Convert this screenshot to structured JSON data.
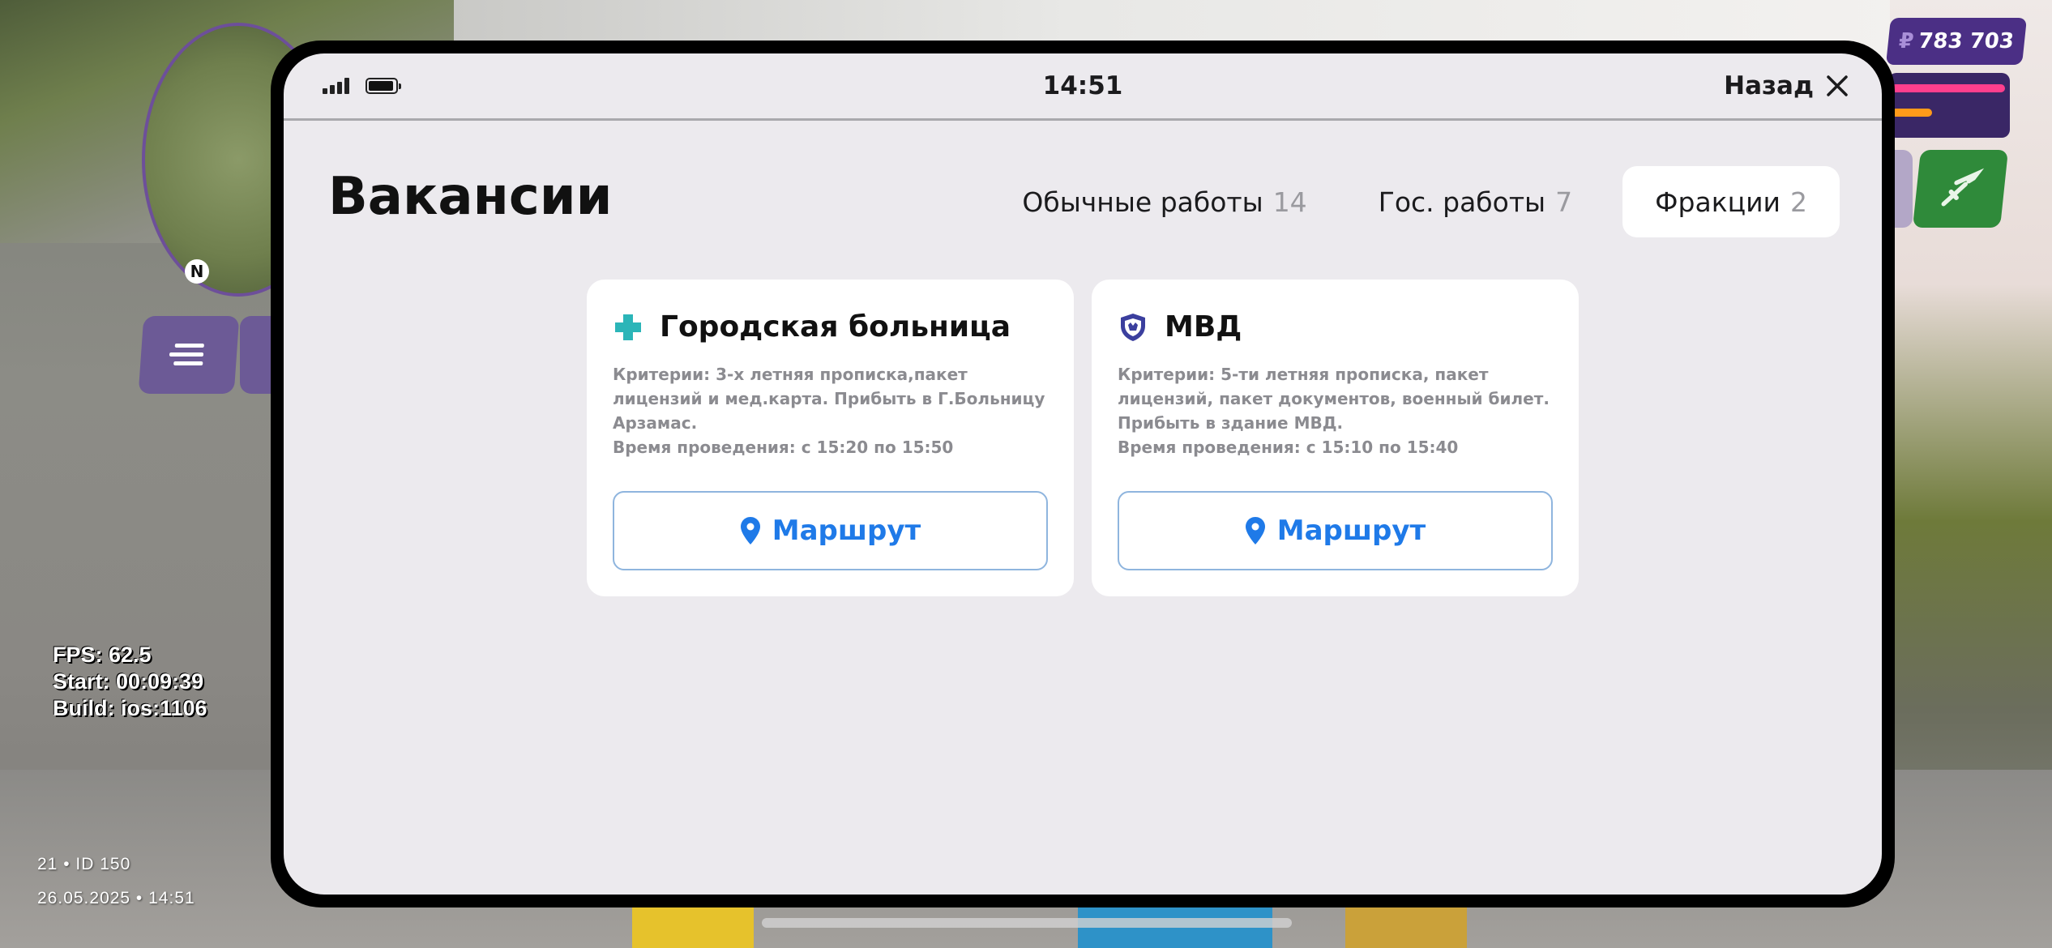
{
  "hud": {
    "money_currency": "₽",
    "money_value": "783 703",
    "compass": "N",
    "debug": {
      "fps": "FPS: 62.5",
      "start": "Start: 00:09:39",
      "build": "Build: ios:1106"
    },
    "footer_id": "21 • ID 150",
    "footer_datetime": "26.05.2025 • 14:51"
  },
  "phone": {
    "time": "14:51",
    "back_label": "Назад",
    "page_title": "Вакансии",
    "tabs": [
      {
        "label": "Обычные работы",
        "count": "14",
        "active": false
      },
      {
        "label": "Гос. работы",
        "count": "7",
        "active": false
      },
      {
        "label": "Фракции",
        "count": "2",
        "active": true
      }
    ],
    "cards": [
      {
        "icon": "medical-cross-icon",
        "title": "Городская больница",
        "desc1": "Критерии: 3-х летняя прописка,пакет лицензий и мед.карта. Прибыть в Г.Больницу Арзамас.",
        "desc2": "Время проведения: с 15:20 по 15:50",
        "button": "Маршрут"
      },
      {
        "icon": "police-shield-icon",
        "title": "МВД",
        "desc1": "Критерии: 5-ти летняя прописка, пакет лицензий, пакет документов, военный билет. Прибыть в здание МВД.",
        "desc2": "Время проведения: с 15:10 по 15:40",
        "button": "Маршрут"
      }
    ]
  },
  "colors": {
    "accent_blue": "#1f7ae8",
    "medical_teal": "#2bb5b8",
    "police_indigo": "#3b3f9e",
    "hud_purple": "#4b2f85"
  }
}
